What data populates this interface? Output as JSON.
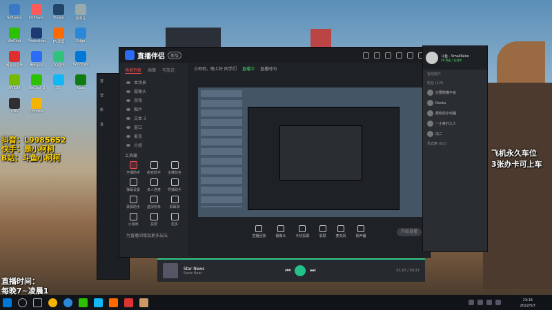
{
  "desktop_icons": [
    {
      "label": "Software",
      "color": "#3a78c8"
    },
    {
      "label": "KKPlayer",
      "color": "#ff5a5a"
    },
    {
      "label": "Steam",
      "color": "#224466"
    },
    {
      "label": "回收站",
      "color": "#9aa"
    },
    {
      "label": "WeChat",
      "color": "#2dc100"
    },
    {
      "label": "Photoshop",
      "color": "#1d3b72"
    },
    {
      "label": "EV录屏",
      "color": "#ff6a00"
    },
    {
      "label": "Edge",
      "color": "#2b88d8"
    },
    {
      "label": "网易云音乐",
      "color": "#e02d2d"
    },
    {
      "label": "腾讯会议",
      "color": "#2b6cf5"
    },
    {
      "label": "QQ音乐",
      "color": "#31c27c"
    },
    {
      "label": "Windows",
      "color": "#0078d7"
    },
    {
      "label": "NVIDIA",
      "color": "#76b900"
    },
    {
      "label": "WeChat_2",
      "color": "#2dc100"
    },
    {
      "label": "QQ",
      "color": "#12b7f5"
    },
    {
      "label": "Xbox",
      "color": "#107c10"
    },
    {
      "label": "OBS",
      "color": "#302e31"
    },
    {
      "label": "Chrome",
      "color": "#f4b400"
    }
  ],
  "overlays": {
    "douyin": "抖音：L9985652",
    "kuaishou": "快手：是小柯柯",
    "bilibili": "B站：斗鱼小柯柯",
    "schedule_label": "直播时间：",
    "schedule_value": "每晚7~凌晨1",
    "promo_line1": "飞机永久车位",
    "promo_line2": "3张办卡可上车"
  },
  "app": {
    "title": "直播伴侣",
    "badge": "新版",
    "tabs": [
      "场景列表",
      "画面",
      "可放送"
    ],
    "active_tab": "场景列表",
    "scenes": [
      "本场景",
      "摄像头",
      "游戏",
      "图片",
      "文本 3",
      "窗口",
      "麦克",
      "分组"
    ],
    "tools_title": "工具箱",
    "tools": [
      {
        "label": "开播助手",
        "red": true
      },
      {
        "label": "房管助手",
        "red": false
      },
      {
        "label": "主播任务",
        "red": false
      },
      {
        "label": "弹幕设置",
        "red": false
      },
      {
        "label": "多人连麦",
        "red": false
      },
      {
        "label": "导播助手",
        "red": false
      },
      {
        "label": "录屏助手",
        "red": false
      },
      {
        "label": "虚拟形象",
        "red": false
      },
      {
        "label": "屏幕录",
        "red": false
      },
      {
        "label": "小游戏",
        "red": false
      },
      {
        "label": "投屏",
        "red": false
      },
      {
        "label": "更多",
        "red": false
      }
    ],
    "footer_hint": "为直播间增加更多玩法",
    "room_label": "小柯柯，晚上好 同学们",
    "status": "直播中",
    "live_label": "直播时间",
    "bottom_tools": [
      "直播回放",
      "摄像头",
      "手机投屏",
      "录屏",
      "麦克风",
      "扬声器"
    ],
    "start_button": "开始直播"
  },
  "music": {
    "title": "Star News",
    "artist": "Sonic Beat",
    "time": "01:07 / 03:37"
  },
  "chat": {
    "user": "斗鱼 · SmallKeke",
    "status": "V8 等级 / 在线中",
    "sections": [
      "在线用户",
      "粉丝 (1/4)",
      "贵宾席 (0/1)"
    ],
    "entries": [
      "只要熊猫不会",
      "Rooka",
      "柔软的小仙猫",
      "一小条打工人",
      "冯二"
    ]
  },
  "taskbar": {
    "time": "13:16",
    "date": "2022/5/7"
  }
}
